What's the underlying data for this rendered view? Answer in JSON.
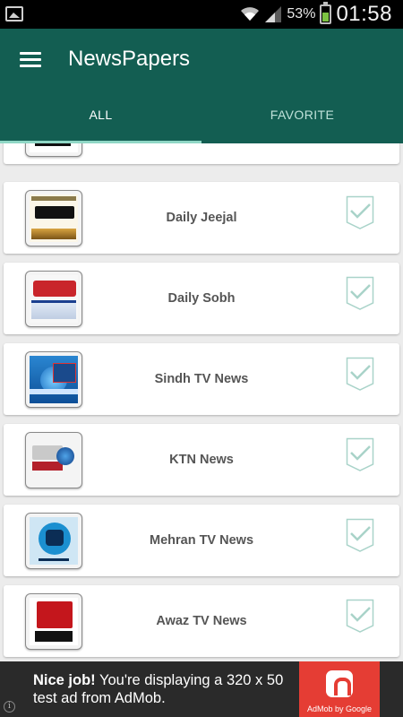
{
  "status_bar": {
    "battery_percent": "53%",
    "time": "01:58",
    "icons": [
      "gallery-icon",
      "wifi-icon",
      "signal-icon",
      "battery-icon"
    ],
    "battery_level": 0.53
  },
  "app_bar": {
    "title": "NewsPapers",
    "menu_icon": "hamburger-menu-icon"
  },
  "tabs": [
    {
      "label": "ALL",
      "active": true
    },
    {
      "label": "FAVORITE",
      "active": false
    }
  ],
  "items": [
    {
      "name": "",
      "logo": "newspaper-logo",
      "favorite": false
    },
    {
      "name": "Daily Jeejal",
      "logo": "daily-jeejal-logo",
      "favorite": false
    },
    {
      "name": "Daily Sobh",
      "logo": "daily-sobh-logo",
      "favorite": false
    },
    {
      "name": "Sindh TV News",
      "logo": "sindh-tv-news-logo",
      "favorite": false
    },
    {
      "name": "KTN News",
      "logo": "ktn-news-logo",
      "favorite": false
    },
    {
      "name": "Mehran TV News",
      "logo": "mehran-tv-news-logo",
      "favorite": false
    },
    {
      "name": "Awaz TV News",
      "logo": "awaz-tv-news-logo",
      "favorite": false
    }
  ],
  "ad": {
    "bold": "Nice job!",
    "text": " You're displaying a 320 x 50 test ad from AdMob.",
    "provider": "AdMob by Google",
    "info_icon": "info-icon"
  },
  "colors": {
    "primary": "#135e52",
    "tab_indicator": "#8fd7c5",
    "checkbox": "#9fcfc4",
    "ad_badge": "#e53d34"
  }
}
